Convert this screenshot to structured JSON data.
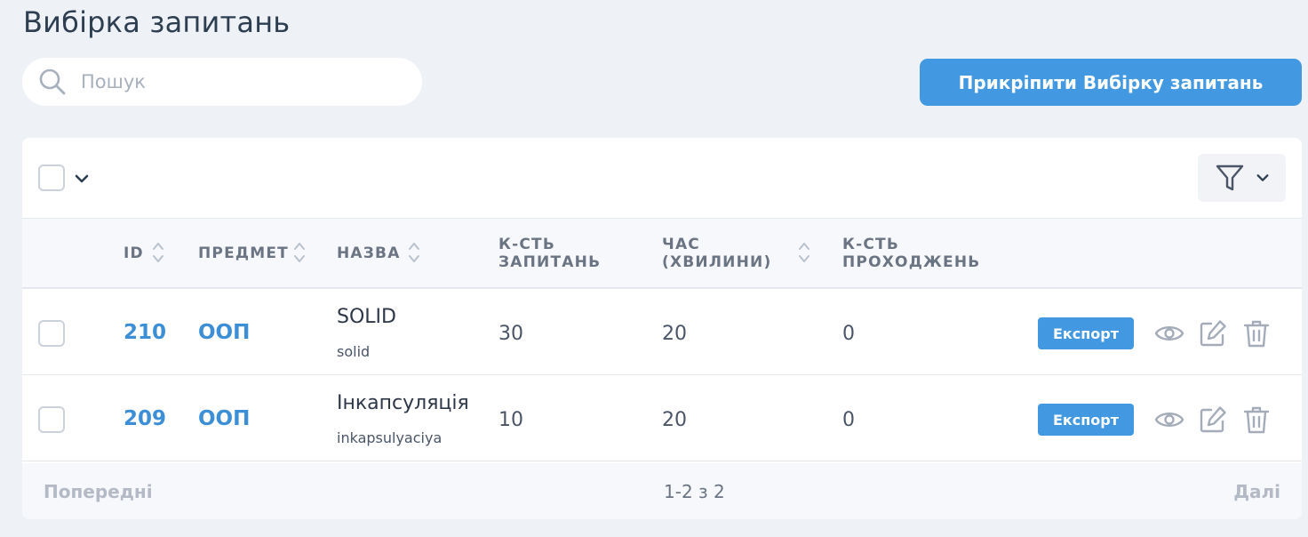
{
  "page": {
    "title": "Вибірка запитань"
  },
  "search": {
    "placeholder": "Пошук",
    "icon": "search-icon"
  },
  "actions": {
    "attach_label": "Прикріпити Вибірку запитань"
  },
  "colors": {
    "accent": "#4299e1",
    "link": "#3c8fd6",
    "background": "#eef1f6"
  },
  "table": {
    "headers": {
      "id": "ID",
      "subject": "Предмет",
      "name": "Назва",
      "questions_count_1": "К-сть",
      "questions_count_2": "запитань",
      "time_1": "Час",
      "time_2": "(хвилини)",
      "passes_1": "К-сть",
      "passes_2": "проходжень"
    },
    "rows": [
      {
        "id": "210",
        "subject": "ООП",
        "name": "SOLID",
        "slug": "solid",
        "questions": "30",
        "minutes": "20",
        "passes": "0",
        "export_label": "Експорт"
      },
      {
        "id": "209",
        "subject": "ООП",
        "name": "Інкапсуляція",
        "slug": "inkapsulyaciya",
        "questions": "10",
        "minutes": "20",
        "passes": "0",
        "export_label": "Експорт"
      }
    ]
  },
  "pagination": {
    "prev_label": "Попередні",
    "info": "1-2 з 2",
    "next_label": "Далі"
  }
}
